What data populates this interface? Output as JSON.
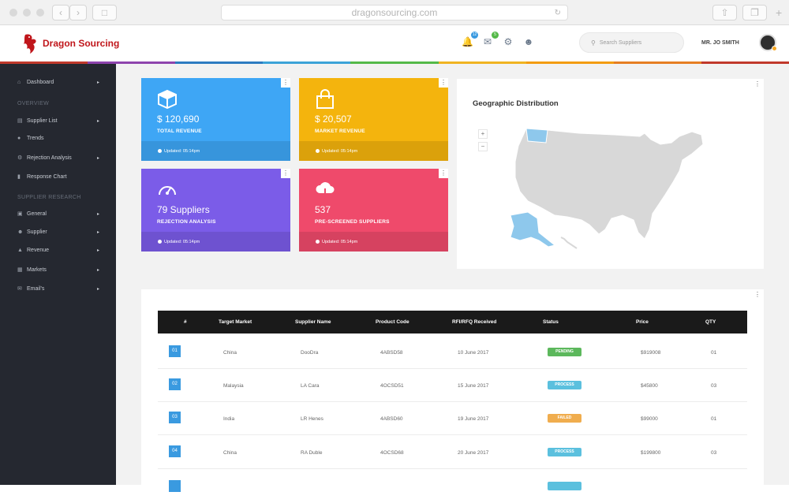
{
  "browser": {
    "url": "dragonsourcing.com"
  },
  "app": {
    "name": "Dragon Sourcing"
  },
  "header": {
    "notifications_badge": "12",
    "messages_badge": "5",
    "search_placeholder": "Search Suppliers",
    "user_name": "MR. JO SMITH"
  },
  "color_strip": [
    "#c0392b",
    "#8e44ad",
    "#2c7bc0",
    "#3ba3d8",
    "#54b948",
    "#f0b321",
    "#f39c12",
    "#e67e22",
    "#c0392b"
  ],
  "sidebar": {
    "dashboard": "Dashboard",
    "overview_heading": "OVERVIEW",
    "overview_items": [
      {
        "label": "Supplier List",
        "icon": "list-icon",
        "has_submenu": true
      },
      {
        "label": "Trends",
        "icon": "droplet-icon",
        "has_submenu": false
      },
      {
        "label": "Rejection Analysis",
        "icon": "gear-icon",
        "has_submenu": true
      },
      {
        "label": "Response Chart",
        "icon": "bar-chart-icon",
        "has_submenu": false
      }
    ],
    "research_heading": "SUPPLIER RESEARCH",
    "research_items": [
      {
        "label": "General",
        "icon": "clipboard-icon",
        "has_submenu": true
      },
      {
        "label": "Supplier",
        "icon": "user-icon",
        "has_submenu": true
      },
      {
        "label": "Revenue",
        "icon": "bag-icon",
        "has_submenu": true
      },
      {
        "label": "Markets",
        "icon": "map-icon",
        "has_submenu": true
      },
      {
        "label": "Email's",
        "icon": "mail-icon",
        "has_submenu": true
      }
    ]
  },
  "cards": [
    {
      "value": "$ 120,690",
      "label": "TOTAL REVENUE",
      "updated": "Updated: 05:14pm",
      "color": "#3ea6f5",
      "icon": "box-icon"
    },
    {
      "value": "$ 20,507",
      "label": "MARKET REVENUE",
      "updated": "Updated: 05:14pm",
      "color": "#f4b40d",
      "icon": "shopping-bag-icon"
    },
    {
      "value": "79 Suppliers",
      "label": "REJECTION ANALYSIS",
      "updated": "Updated: 05:14pm",
      "color": "#7b5ce8",
      "icon": "gauge-icon"
    },
    {
      "value": "537",
      "label": "PRE-SCREENED SUPPLIERS",
      "updated": "Updated: 05:14pm",
      "color": "#ef4a6b",
      "icon": "cloud-download-icon"
    }
  ],
  "geo": {
    "title": "Geographic Distribution",
    "zoom_in": "+",
    "zoom_out": "−",
    "highlight_color": "#8ec8ec",
    "land_color": "#d8d8d8"
  },
  "table": {
    "columns": [
      "#",
      "Target Market",
      "Supplier Name",
      "Product Code",
      "RFI/RFQ Received",
      "Status",
      "Price",
      "QTY"
    ],
    "rows": [
      {
        "num": "01",
        "market": "China",
        "supplier": "DooDra",
        "code": "4ABSD58",
        "received": "10 June 2017",
        "status": "PENDING",
        "status_color": "#5cb85c",
        "price": "$919008",
        "qty": "01"
      },
      {
        "num": "02",
        "market": "Malaysia",
        "supplier": "LA Cara",
        "code": "4OCSD51",
        "received": "15 June 2017",
        "status": "PROCESS",
        "status_color": "#5bc0de",
        "price": "$45800",
        "qty": "03"
      },
      {
        "num": "03",
        "market": "India",
        "supplier": "LR Henes",
        "code": "4ABSD60",
        "received": "19 June 2017",
        "status": "FAILED",
        "status_color": "#f0ad4e",
        "price": "$99000",
        "qty": "01"
      },
      {
        "num": "04",
        "market": "China",
        "supplier": "RA Duble",
        "code": "4OCSD68",
        "received": "20 June 2017",
        "status": "PROCESS",
        "status_color": "#5bc0de",
        "price": "$199800",
        "qty": "03"
      }
    ]
  }
}
